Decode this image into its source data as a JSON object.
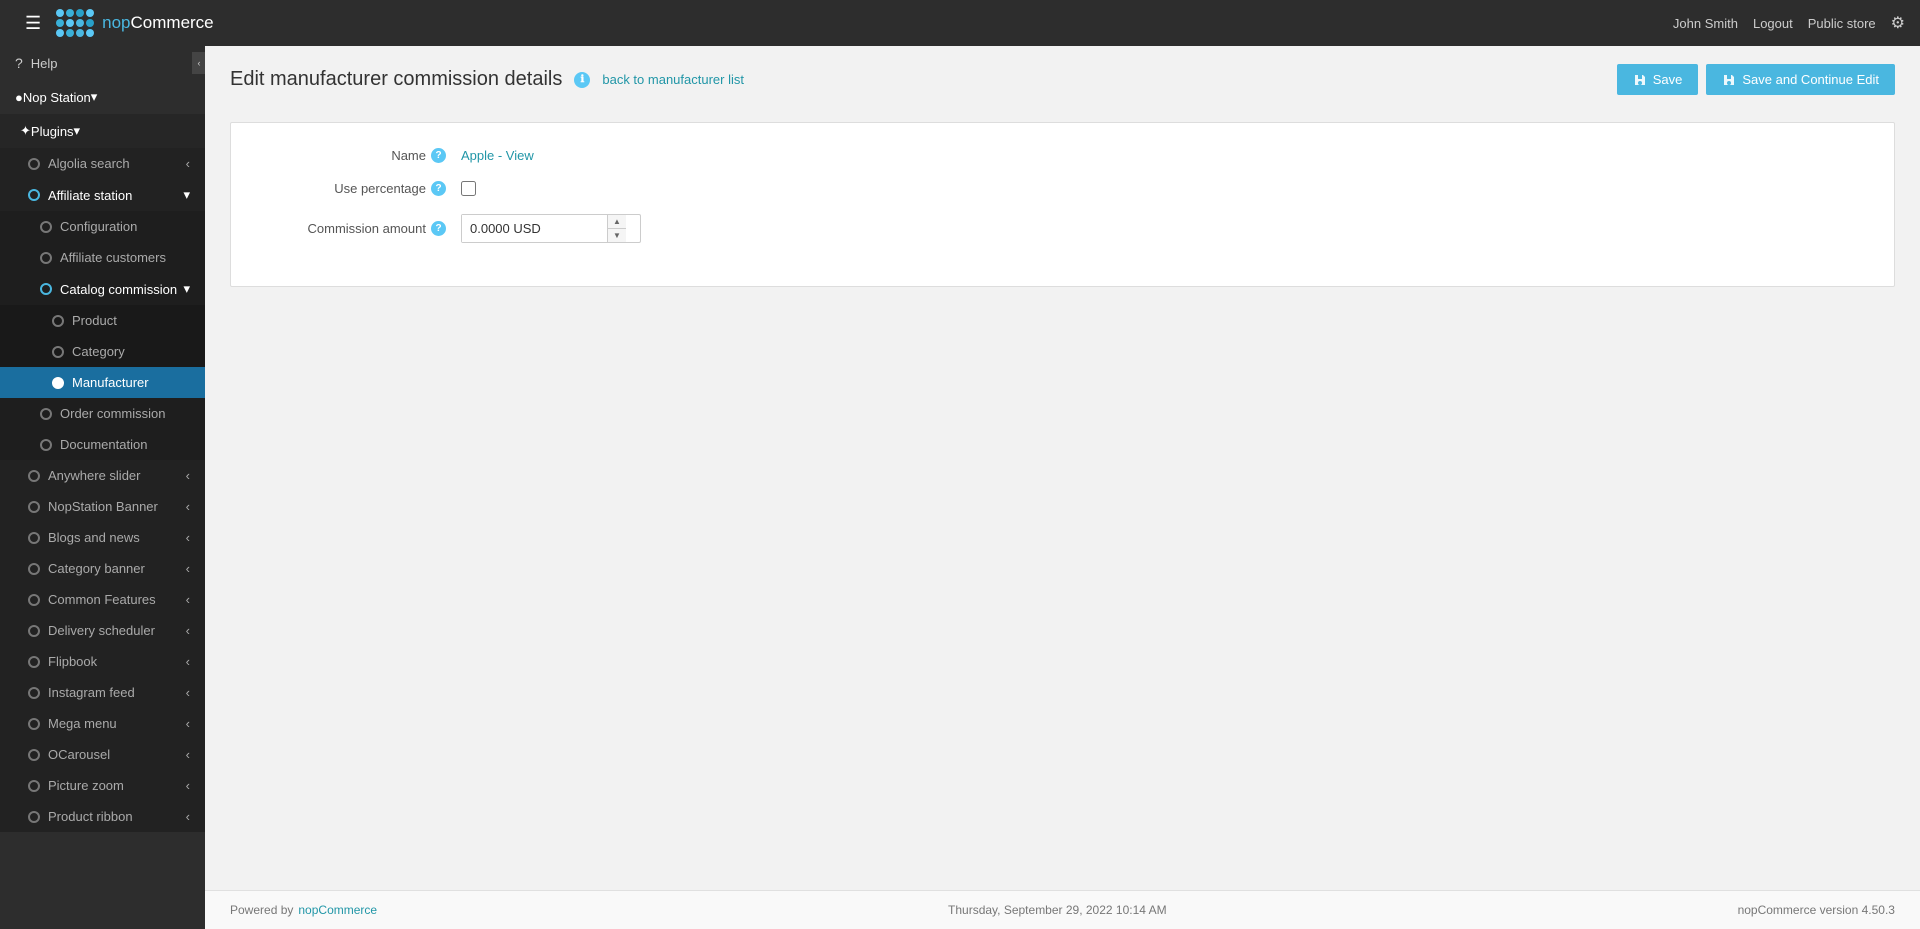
{
  "topbar": {
    "logo_text_nop": "nop",
    "logo_text_commerce": "Commerce",
    "hamburger_label": "☰",
    "username": "John Smith",
    "logout_label": "Logout",
    "public_store_label": "Public store",
    "settings_icon": "⚙"
  },
  "sidebar": {
    "help_label": "Help",
    "nop_station_label": "Nop Station",
    "plugins_label": "Plugins",
    "algolia_search_label": "Algolia search",
    "affiliate_station_label": "Affiliate station",
    "configuration_label": "Configuration",
    "affiliate_customers_label": "Affiliate customers",
    "catalog_commission_label": "Catalog commission",
    "product_label": "Product",
    "category_label": "Category",
    "manufacturer_label": "Manufacturer",
    "order_commission_label": "Order commission",
    "documentation_label": "Documentation",
    "anywhere_slider_label": "Anywhere slider",
    "nopstation_banner_label": "NopStation Banner",
    "blogs_and_news_label": "Blogs and news",
    "category_banner_label": "Category banner",
    "common_features_label": "Common Features",
    "delivery_scheduler_label": "Delivery scheduler",
    "flipbook_label": "Flipbook",
    "instagram_feed_label": "Instagram feed",
    "mega_menu_label": "Mega menu",
    "ocarousel_label": "OCarousel",
    "picture_zoom_label": "Picture zoom",
    "product_ribbon_label": "Product ribbon"
  },
  "page": {
    "title": "Edit manufacturer commission details",
    "back_link_icon": "ℹ",
    "back_link_text": "back to manufacturer list",
    "save_label": "Save",
    "save_icon": "💾",
    "save_continue_label": "Save and Continue Edit",
    "save_continue_icon": "💾"
  },
  "form": {
    "name_label": "Name",
    "name_value": "Apple - View",
    "use_percentage_label": "Use percentage",
    "commission_amount_label": "Commission amount",
    "commission_amount_value": "0.0000 USD"
  },
  "footer": {
    "powered_by_text": "Powered by",
    "powered_by_link": "nopCommerce",
    "datetime": "Thursday, September 29, 2022 10:14 AM",
    "version": "nopCommerce version 4.50.3"
  }
}
